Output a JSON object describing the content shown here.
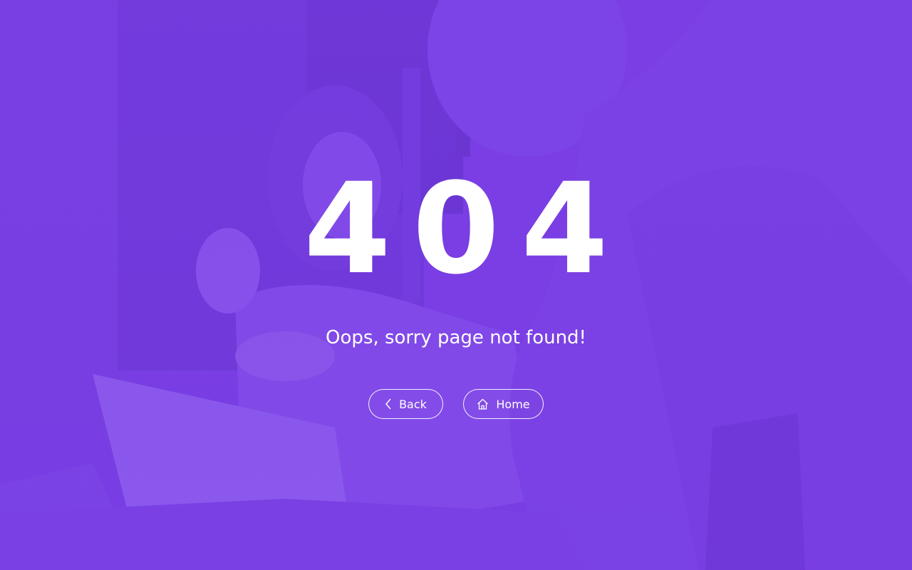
{
  "error": {
    "code": "404",
    "message": "Oops, sorry page not found!"
  },
  "actions": {
    "back_label": "Back",
    "home_label": "Home"
  },
  "icons": {
    "back": "chevron-left-icon",
    "home": "home-icon"
  },
  "colors": {
    "overlay": "#7a3ee0",
    "text": "#ffffff"
  }
}
